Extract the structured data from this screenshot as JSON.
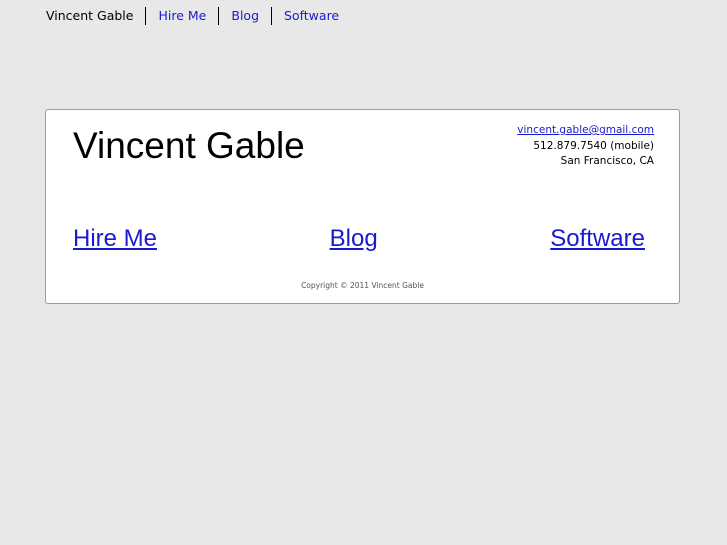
{
  "topnav": {
    "items": [
      {
        "label": "Vincent Gable"
      },
      {
        "label": "Hire Me"
      },
      {
        "label": "Blog"
      },
      {
        "label": "Software"
      }
    ]
  },
  "card": {
    "name": "Vincent Gable",
    "contact": {
      "email": "vincent.gable@gmail.com",
      "phone": "512.879.7540 (mobile)",
      "location": "San Francisco, CA"
    },
    "links": [
      {
        "label": "Hire Me"
      },
      {
        "label": "Blog"
      },
      {
        "label": "Software"
      }
    ],
    "copyright": "Copyright © 2011 Vincent Gable"
  },
  "colors": {
    "link": "#1a1acc",
    "background": "#e8e8e8"
  }
}
